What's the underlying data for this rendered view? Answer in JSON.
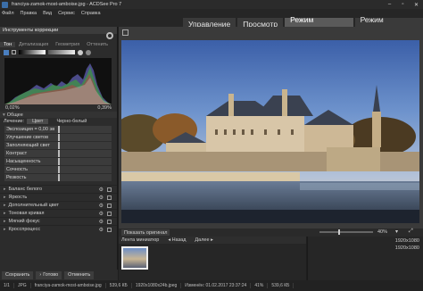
{
  "window": {
    "title": "franciya-zamok-most-amboise.jpg - ACDSee Pro 7"
  },
  "menu": [
    "Файл",
    "Правка",
    "Вид",
    "Сервис",
    "Справка"
  ],
  "modes": [
    {
      "label": "Управление",
      "active": false
    },
    {
      "label": "Просмотр",
      "active": false
    },
    {
      "label": "Режим коррекции",
      "active": true
    },
    {
      "label": "Режим редактора",
      "active": false
    }
  ],
  "left_panel": {
    "title": "Инструменты коррекции",
    "subtabs": [
      "Тон",
      "Детализация",
      "Геометрия",
      "Оттенить"
    ],
    "histogram_left_pct": "0,02%",
    "histogram_right_pct": "0,39%",
    "sections": {
      "general": "Общее"
    },
    "color_mode": {
      "label": "Лечение:",
      "tab_color": "Цвет",
      "tab_bw": "Черно-белый"
    },
    "sliders": [
      {
        "label": "Экспозиция = 0,00 эв",
        "value": 0.0
      },
      {
        "label": "Улучшение светов",
        "value": 0.0
      },
      {
        "label": "Заполняющий свет",
        "value": 0.0
      },
      {
        "label": "Контраст",
        "value": 0.0
      },
      {
        "label": "Насыщенность",
        "value": 0.0
      },
      {
        "label": "Сочность",
        "value": 0.0
      },
      {
        "label": "Резкость",
        "value": 0.0
      }
    ],
    "tools": [
      "Баланс белого",
      "Яркость",
      "Дополнительный цвет",
      "Тоновая кривая",
      "Мягкий фокус",
      "Кросспроцесс"
    ],
    "buttons": {
      "save": "Сохранить",
      "done": "Готово",
      "cancel": "Отменить"
    }
  },
  "image_controls": {
    "show_original": "Показать оригинал",
    "zoom": "40%"
  },
  "filmstrip": {
    "title": "Лента миниатюр",
    "back": "Назад",
    "next": "Далее"
  },
  "info_panel": {
    "dimensions_a": "1920x1080",
    "dimensions_b": "1920x1080"
  },
  "status": {
    "counter": "1/1",
    "type": "JPG",
    "filename": "franciya-zamok-most-amboise.jpg",
    "size": "539,6 КБ",
    "resolution": "1920x1080x24b.jpeg",
    "modified": "Изменён: 01.02.2017 23:37:24",
    "zoom": "41%",
    "extra": "539,6 КБ"
  }
}
